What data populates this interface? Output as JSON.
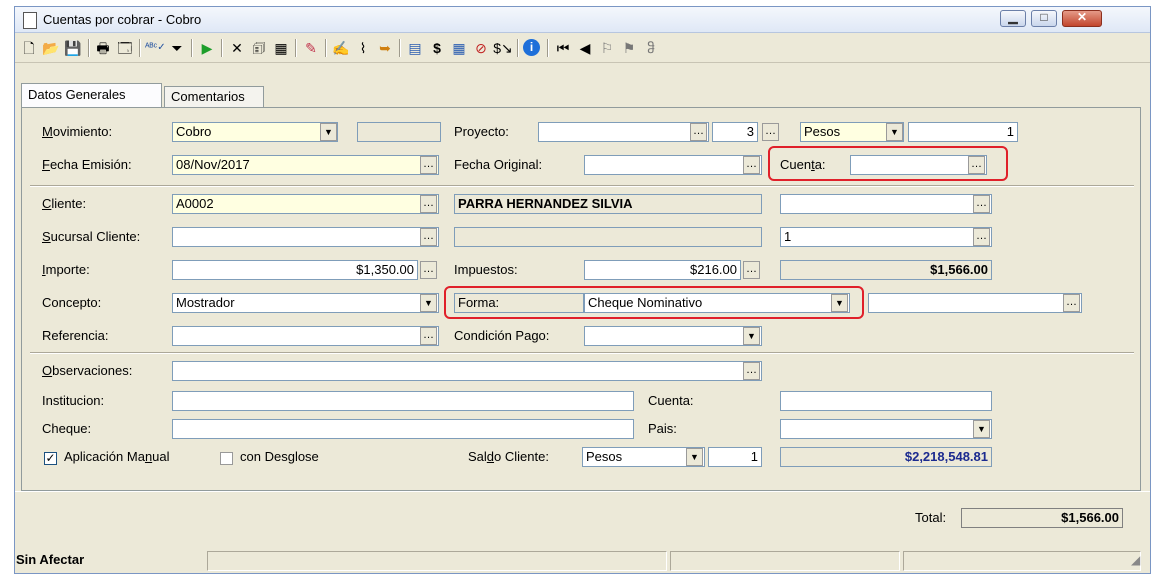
{
  "window": {
    "title": "Cuentas por cobrar - Cobro",
    "controls": [
      "minimize",
      "maximize",
      "close"
    ]
  },
  "toolbar_icons": [
    "new-doc-icon",
    "open-folder-icon",
    "save-icon",
    "print-icon",
    "print-preview-icon",
    "spell-check-icon",
    "filter-icon",
    "affect-play-icon",
    "cancel-x-icon",
    "notes-icon",
    "calendar-icon",
    "brush-icon",
    "edit-icon",
    "attachment-icon",
    "import-icon",
    "money-icon",
    "dollar-icon",
    "calculator-icon",
    "no-money-icon",
    "dollar-arrow-icon",
    "info-icon",
    "first-record-icon",
    "prev-record-icon",
    "flag-icon",
    "flag-outline-icon",
    "users-icon"
  ],
  "tabs": [
    {
      "label": "Datos Generales",
      "active": true
    },
    {
      "label": "Comentarios",
      "active": false
    }
  ],
  "form": {
    "movimiento": {
      "label": "Movimiento:",
      "value": "Cobro",
      "extra": ""
    },
    "proyecto": {
      "label": "Proyecto:",
      "value": "",
      "number": "3"
    },
    "moneda": {
      "value": "Pesos",
      "tipo_cambio": "1"
    },
    "fecha_emision": {
      "label": "Fecha Emisión:",
      "value": "08/Nov/2017"
    },
    "fecha_original": {
      "label": "Fecha Original:",
      "value": ""
    },
    "cuenta_top": {
      "label": "Cuenta:",
      "value": ""
    },
    "cliente": {
      "label": "Cliente:",
      "value": "A0002",
      "name": "PARRA HERNANDEZ SILVIA",
      "extra": ""
    },
    "sucursal": {
      "label": "Sucursal Cliente:",
      "value": "",
      "name": "",
      "extra": "1"
    },
    "importe": {
      "label": "Importe:",
      "value": "$1,350.00"
    },
    "impuestos": {
      "label": "Impuestos:",
      "value": "$216.00"
    },
    "total_importe": "$1,566.00",
    "concepto": {
      "label": "Concepto:",
      "value": "Mostrador"
    },
    "forma": {
      "label": "Forma:",
      "value": "Cheque Nominativo",
      "extra": ""
    },
    "referencia": {
      "label": "Referencia:",
      "value": ""
    },
    "condicion_pago": {
      "label": "Condición Pago:",
      "value": ""
    },
    "observaciones": {
      "label": "Observaciones:",
      "value": ""
    },
    "institucion": {
      "label": "Institucion:",
      "value": ""
    },
    "cuenta_bank": {
      "label": "Cuenta:",
      "value": ""
    },
    "cheque": {
      "label": "Cheque:",
      "value": ""
    },
    "pais": {
      "label": "Pais:",
      "value": ""
    },
    "aplicacion_manual": {
      "label": "Aplicación Manual",
      "checked": true
    },
    "con_desglose": {
      "label": "con Desglose",
      "checked": false
    },
    "saldo_cliente": {
      "label": "Saldo Cliente:",
      "moneda": "Pesos",
      "tipo_cambio": "1",
      "value": "$2,218,548.81"
    }
  },
  "footer": {
    "total_label": "Total:",
    "total_value": "$1,566.00"
  },
  "status": {
    "text": "Sin Afectar"
  },
  "colors": {
    "highlight_red": "#e0202a",
    "saldo_blue": "#1b2a8f",
    "required_field": "#ffffe1"
  }
}
